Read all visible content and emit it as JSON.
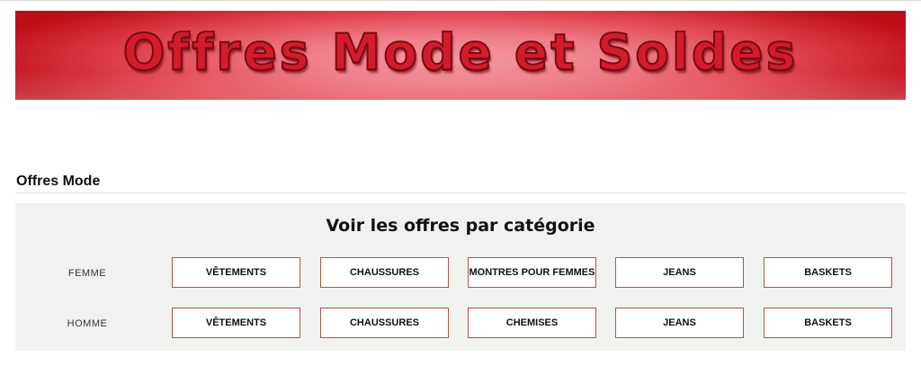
{
  "banner": {
    "title": "Offres Mode et Soldes"
  },
  "section": {
    "title": "Offres Mode"
  },
  "panel": {
    "title": "Voir les offres par catégorie"
  },
  "rows": [
    {
      "label": "FEMME",
      "buttons": [
        "VÊTEMENTS",
        "CHAUSSURES",
        "MONTRES POUR FEMMES",
        "JEANS",
        "BASKETS"
      ]
    },
    {
      "label": "HOMME",
      "buttons": [
        "VÊTEMENTS",
        "CHAUSSURES",
        "CHEMISES",
        "JEANS",
        "BASKETS"
      ]
    }
  ]
}
